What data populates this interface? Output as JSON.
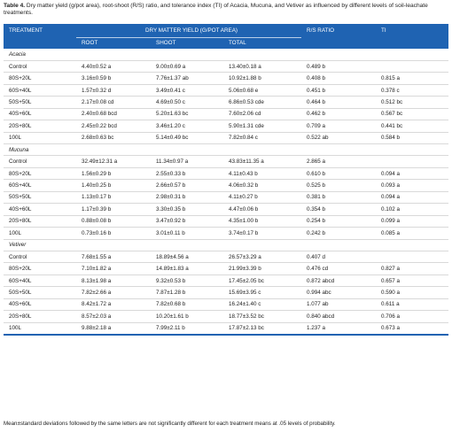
{
  "caption": {
    "label": "Table 4.",
    "text": "Dry matter yield (g/pot area), root-shoot (R/S) ratio, and tolerance index (TI) of Acacia, Mucuna, and Vetiver as influenced by different levels of soil-leachate treatments."
  },
  "header": {
    "treatment": "TREATMENT",
    "group": "DRY MATTER YIELD (G/POT AREA)",
    "rs": "R/S RATIO",
    "ti": "TI",
    "root": "ROOT",
    "shoot": "SHOOT",
    "total": "TOTAL"
  },
  "sections": [
    {
      "name": "Acacia",
      "rows": [
        {
          "treatment": "Control",
          "root": "4.40±0.52 a",
          "shoot": "9.00±0.69 a",
          "total": "13.40±0.18 a",
          "rs": "0.489 b",
          "ti": ""
        },
        {
          "treatment": "80S+20L",
          "root": "3.16±0.59 b",
          "shoot": "7.76±1.37 ab",
          "total": "10.92±1.88 b",
          "rs": "0.408 b",
          "ti": "0.815 a"
        },
        {
          "treatment": "60S+40L",
          "root": "1.57±0.32 d",
          "shoot": "3.49±0.41 c",
          "total": "5.06±0.68 e",
          "rs": "0.451 b",
          "ti": "0.378 c"
        },
        {
          "treatment": "50S+50L",
          "root": "2.17±0.08 cd",
          "shoot": "4.69±0.50 c",
          "total": "6.86±0.53 cde",
          "rs": "0.464 b",
          "ti": "0.512 bc"
        },
        {
          "treatment": "40S+60L",
          "root": "2.40±0.68 bcd",
          "shoot": "5.20±1.63 bc",
          "total": "7.60±2.06 cd",
          "rs": "0.462 b",
          "ti": "0.567 bc"
        },
        {
          "treatment": "20S+80L",
          "root": "2.45±0.22 bcd",
          "shoot": "3.46±1.20 c",
          "total": "5.90±1.31 cde",
          "rs": "0.709 a",
          "ti": "0.441 bc"
        },
        {
          "treatment": "100L",
          "root": "2.68±0.63 bc",
          "shoot": "5.14±0.49 bc",
          "total": "7.82±0.84 c",
          "rs": "0.522 ab",
          "ti": "0.584 b"
        }
      ]
    },
    {
      "name": "Mucuna",
      "rows": [
        {
          "treatment": "Control",
          "root": "32.49±12.31 a",
          "shoot": "11.34±0.97 a",
          "total": "43.83±11.35 a",
          "rs": "2.865 a",
          "ti": ""
        },
        {
          "treatment": "80S+20L",
          "root": "1.56±0.29 b",
          "shoot": "2.55±0.33 b",
          "total": "4.11±0.43 b",
          "rs": "0.610 b",
          "ti": "0.094 a"
        },
        {
          "treatment": "60S+40L",
          "root": "1.40±0.25 b",
          "shoot": "2.66±0.57 b",
          "total": "4.06±0.32 b",
          "rs": "0.525 b",
          "ti": "0.093 a"
        },
        {
          "treatment": "50S+50L",
          "root": "1.13±0.17 b",
          "shoot": "2.98±0.31 b",
          "total": "4.11±0.27 b",
          "rs": "0.381 b",
          "ti": "0.094 a"
        },
        {
          "treatment": "40S+60L",
          "root": "1.17±0.39 b",
          "shoot": "3.30±0.35 b",
          "total": "4.47±0.06 b",
          "rs": "0.354 b",
          "ti": "0.102 a"
        },
        {
          "treatment": "20S+80L",
          "root": "0.88±0.08 b",
          "shoot": "3.47±0.92 b",
          "total": "4.35±1.00 b",
          "rs": "0.254 b",
          "ti": "0.099 a"
        },
        {
          "treatment": "100L",
          "root": "0.73±0.16 b",
          "shoot": "3.01±0.11 b",
          "total": "3.74±0.17 b",
          "rs": "0.242 b",
          "ti": "0.085 a"
        }
      ]
    },
    {
      "name": "Vetiver",
      "rows": [
        {
          "treatment": "Control",
          "root": "7.68±1.55 a",
          "shoot": "18.89±4.56 a",
          "total": "26.57±3.29 a",
          "rs": "0.407 d",
          "ti": ""
        },
        {
          "treatment": "80S+20L",
          "root": "7.10±1.82 a",
          "shoot": "14.89±1.83 a",
          "total": "21.99±3.39 b",
          "rs": "0.476 cd",
          "ti": "0.827 a"
        },
        {
          "treatment": "60S+40L",
          "root": "8.13±1.98 a",
          "shoot": "9.32±0.53 b",
          "total": "17.45±2.05 bc",
          "rs": "0.872 abcd",
          "ti": "0.657 a"
        },
        {
          "treatment": "50S+50L",
          "root": "7.82±2.66 a",
          "shoot": "7.87±1.28 b",
          "total": "15.69±3.95 c",
          "rs": "0.994 abc",
          "ti": "0.590 a"
        },
        {
          "treatment": "40S+60L",
          "root": "8.42±1.72 a",
          "shoot": "7.82±0.68 b",
          "total": "16.24±1.40 c",
          "rs": "1.077 ab",
          "ti": "0.611 a"
        },
        {
          "treatment": "20S+80L",
          "root": "8.57±2.03 a",
          "shoot": "10.20±1.61 b",
          "total": "18.77±3.52 bc",
          "rs": "0.840 abcd",
          "ti": "0.706 a"
        },
        {
          "treatment": "100L",
          "root": "9.88±2.18 a",
          "shoot": "7.99±2.11 b",
          "total": "17.87±2.13 bc",
          "rs": "1.237 a",
          "ti": "0.673 a"
        }
      ]
    }
  ],
  "footnote": "Mean±standard deviations followed by the same letters are not significantly different for each treatment means at .05 levels of probability."
}
